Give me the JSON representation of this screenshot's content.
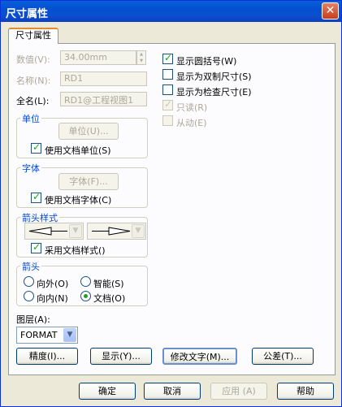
{
  "window": {
    "title": "尺寸属性",
    "close_glyph": "✕"
  },
  "tab": {
    "label": "尺寸属性"
  },
  "fields": {
    "value_label": "数值(V):",
    "value": "34.00mm",
    "name_label": "名称(N):",
    "name": "RD1",
    "fullname_label": "全名(L):",
    "fullname": "RD1@工程视图1"
  },
  "unit_group": {
    "title": "单位",
    "button": "单位(U)...",
    "checkbox": "使用文档单位(S)",
    "checked": true
  },
  "font_group": {
    "title": "字体",
    "button": "字体(F)...",
    "checkbox": "使用文档字体(C)",
    "checked": true
  },
  "arrowstyle_group": {
    "title": "箭头样式",
    "checkbox": "采用文档样式()",
    "checked": true
  },
  "arrow_group": {
    "title": "箭头",
    "options": [
      "向外(O)",
      "智能(S)",
      "向内(N)",
      "文档(O)"
    ],
    "selected": "文档(O)"
  },
  "layer": {
    "label": "图层(A):",
    "value": "FORMAT"
  },
  "right_checks": [
    {
      "label": "显示圆括号(W)",
      "checked": true,
      "disabled": false
    },
    {
      "label": "显示为双制尺寸(S)",
      "checked": false,
      "disabled": false
    },
    {
      "label": "显示为检查尺寸(E)",
      "checked": false,
      "disabled": false
    },
    {
      "label": "只读(R)",
      "checked": true,
      "disabled": true
    },
    {
      "label": "从动(E)",
      "checked": false,
      "disabled": true
    }
  ],
  "bottom_buttons": [
    "精度(I)...",
    "显示(Y)...",
    "修改文字(M)...",
    "公差(T)..."
  ],
  "dialog_buttons": {
    "ok": "确定",
    "cancel": "取消",
    "apply": "应用 (A)",
    "help": "帮助"
  },
  "colors": {
    "title_bar": "#0a5fd8",
    "group_title": "#0046d5",
    "check_mark": "#21a121"
  }
}
